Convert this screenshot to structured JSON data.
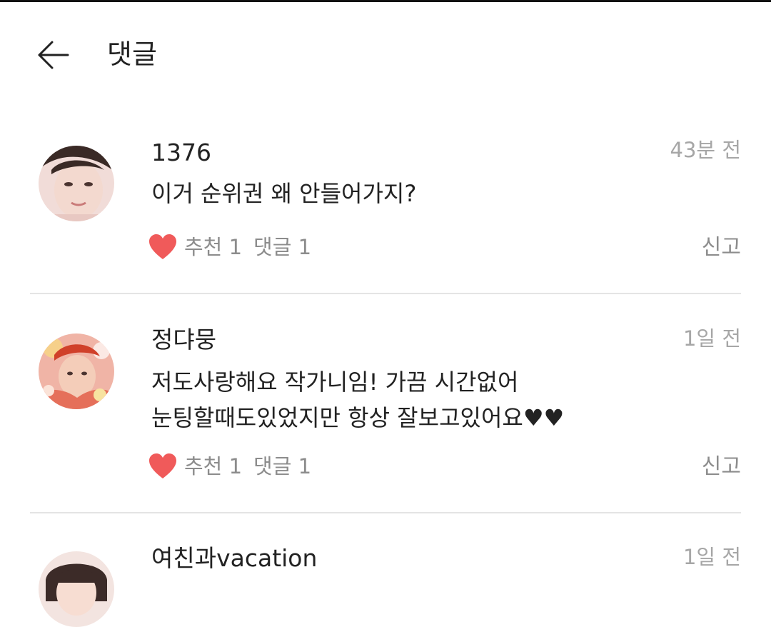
{
  "header": {
    "title": "댓글",
    "back_icon": "arrow-left-icon"
  },
  "colors": {
    "heart": "#f05a5a",
    "meta": "#8c8c8c",
    "timestamp": "#a6a6a6",
    "divider": "#e4e4e4"
  },
  "comments": [
    {
      "username": "1376",
      "time": "43분 전",
      "text": "이거 순위권 왜 안들어가지?",
      "recommend_label": "추천 1",
      "reply_label": "댓글 1",
      "report_label": "신고"
    },
    {
      "username": "정댜뭉",
      "time": "1일 전",
      "text": "저도사랑해요 작가니임! 가끔 시간없어\n눈팅할때도있었지만 항상 잘보고있어요♥♥",
      "recommend_label": "추천 1",
      "reply_label": "댓글 1",
      "report_label": "신고"
    },
    {
      "username": "여친과vacation",
      "time": "1일 전"
    }
  ]
}
